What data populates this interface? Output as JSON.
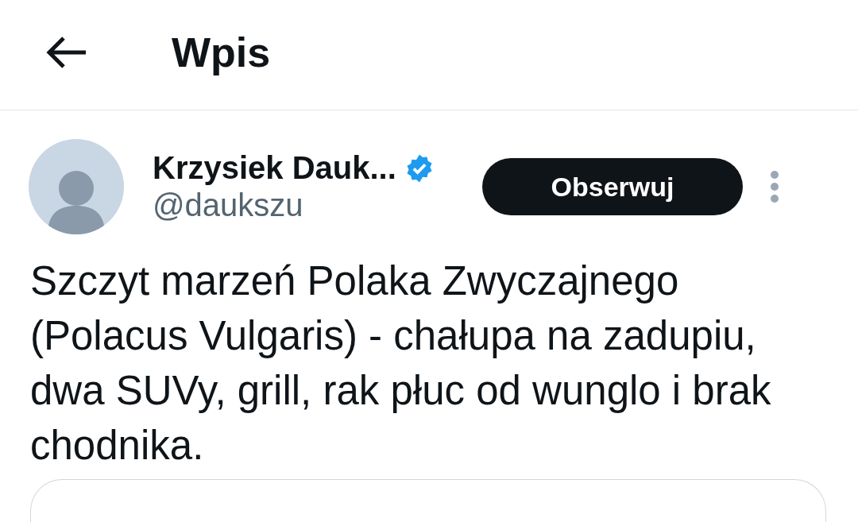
{
  "header": {
    "title": "Wpis"
  },
  "author": {
    "name": "Krzysiek Dauk...",
    "verified": true,
    "handle": "@daukszu",
    "follow_button": "Obserwuj"
  },
  "post": {
    "text": "Szczyt marzeń Polaka Zwyczajnego (Polacus Vulgaris) - chałupa na zadupiu, dwa SUVy, grill, rak płuc od wunglo i brak chodnika."
  }
}
